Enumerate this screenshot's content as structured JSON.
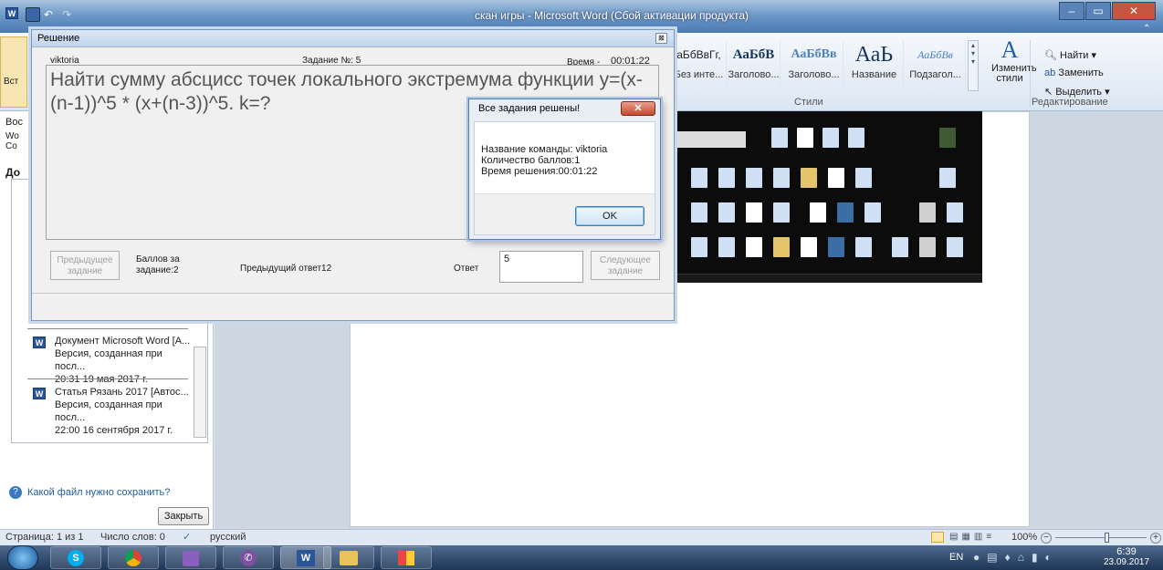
{
  "word": {
    "window_title": "скан игры - Microsoft Word (Сбой активации продукта)",
    "styles": [
      {
        "sample": "аБбВвГг,",
        "name": "Без инте..."
      },
      {
        "sample": "АаБбВ",
        "name": "Заголово..."
      },
      {
        "sample": "АаБбВв",
        "name": "Заголово..."
      },
      {
        "sample": "АаЬ",
        "name": "Название"
      },
      {
        "sample": "АаБбВв",
        "name": "Подзагол..."
      }
    ],
    "styles_group_label": "Стили",
    "change_styles": "Изменить стили",
    "find": "Найти",
    "replace": "Заменить",
    "select": "Выделить",
    "editing_group_label": "Редактирование",
    "left_pane": {
      "partial_labels": [
        "Boc",
        "Wo",
        "Co",
        "До"
      ],
      "recent": [
        {
          "title": "Документ Microsoft Word [А...",
          "line2": "Версия, созданная при посл...",
          "line3": "20:31 19 мая 2017 г."
        },
        {
          "title": "Статья Рязань 2017 [Автос...",
          "line2": "Версия, созданная при посл...",
          "line3": "22:00 16 сентября 2017 г."
        }
      ],
      "help_link": "Какой файл нужно сохранить?",
      "close_button": "Закрыть"
    },
    "statusbar": {
      "page": "Страница: 1 из 1",
      "words": "Число слов: 0",
      "language": "русский",
      "zoom": "100%"
    }
  },
  "taskbar": {
    "lang": "EN",
    "time": "6:39",
    "date": "23.09.2017"
  },
  "dialog": {
    "title": "Решение",
    "team": "viktoria",
    "task_label": "Задание №: 5",
    "time_label": "Время -",
    "time_value": "00:01:22",
    "question": "Найти сумму абсцисс точек локального экстремума функции y=(x-(n-1))^5 * (x+(n-3))^5. k=?",
    "prev_button": "Предыдущее задание",
    "points_label": "Баллов за задание:2",
    "prev_answer": "Предыдущий ответ12",
    "answer_label": "Ответ",
    "answer_value": "5",
    "next_button": "Следующее задание"
  },
  "messagebox": {
    "title": "Все задания решены!",
    "line1": "Название команды: viktoria",
    "line2": "Количество баллов:1",
    "line3": "Время решения:00:01:22",
    "ok": "OK"
  },
  "colors": {
    "accent": "#4a7ab3",
    "word_blue": "#2a5699"
  }
}
